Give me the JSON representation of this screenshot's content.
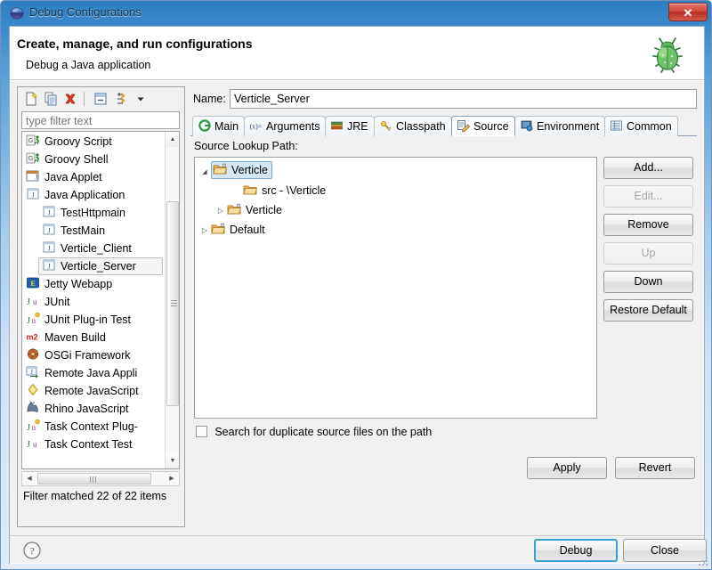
{
  "window": {
    "title": "Debug Configurations",
    "icon": "debug-sphere-icon",
    "close_label": "✕"
  },
  "banner": {
    "title": "Create, manage, and run configurations",
    "subtitle": "Debug a Java application",
    "icon": "green-bug-icon"
  },
  "left_panel": {
    "toolbar": [
      {
        "name": "new-configuration-icon",
        "title": "New launch configuration"
      },
      {
        "name": "duplicate-configuration-icon",
        "title": "Duplicate currently selected launch configuration"
      },
      {
        "name": "delete-configuration-icon",
        "title": "Delete selected launch configuration(s)"
      },
      {
        "name": "collapse-all-icon",
        "title": "Collapse All"
      },
      {
        "name": "filter-launch-configurations-icon",
        "title": "Filter launch configurations"
      },
      {
        "name": "view-menu-chevron-icon",
        "title": "View Menu"
      }
    ],
    "filter": {
      "placeholder": "type filter text",
      "value": ""
    },
    "tree": [
      {
        "label": "Groovy Script",
        "icon": "groovy-script-icon",
        "indent": 0,
        "selected": false
      },
      {
        "label": "Groovy Shell",
        "icon": "groovy-shell-icon",
        "indent": 0,
        "selected": false
      },
      {
        "label": "Java Applet",
        "icon": "java-applet-icon",
        "indent": 0,
        "selected": false
      },
      {
        "label": "Java Application",
        "icon": "java-application-icon",
        "indent": 0,
        "selected": false
      },
      {
        "label": "TestHttpmain",
        "icon": "java-launch-icon",
        "indent": 1,
        "selected": false
      },
      {
        "label": "TestMain",
        "icon": "java-launch-icon",
        "indent": 1,
        "selected": false
      },
      {
        "label": "Verticle_Client",
        "icon": "java-launch-icon",
        "indent": 1,
        "selected": false
      },
      {
        "label": "Verticle_Server",
        "icon": "java-launch-icon",
        "indent": 1,
        "selected": true
      },
      {
        "label": "Jetty Webapp",
        "icon": "jetty-webapp-icon",
        "indent": 0,
        "selected": false
      },
      {
        "label": "JUnit",
        "icon": "junit-icon",
        "indent": 0,
        "selected": false
      },
      {
        "label": "JUnit Plug-in Test",
        "icon": "junit-plugin-test-icon",
        "indent": 0,
        "selected": false
      },
      {
        "label": "Maven Build",
        "icon": "maven-build-icon",
        "indent": 0,
        "selected": false
      },
      {
        "label": "OSGi Framework",
        "icon": "osgi-framework-icon",
        "indent": 0,
        "selected": false
      },
      {
        "label": "Remote Java Appli",
        "icon": "remote-java-application-icon",
        "indent": 0,
        "selected": false
      },
      {
        "label": "Remote JavaScript",
        "icon": "remote-javascript-icon",
        "indent": 0,
        "selected": false
      },
      {
        "label": "Rhino JavaScript",
        "icon": "rhino-javascript-icon",
        "indent": 0,
        "selected": false
      },
      {
        "label": "Task Context Plug-",
        "icon": "task-context-plugin-icon",
        "indent": 0,
        "selected": false
      },
      {
        "label": "Task Context Test",
        "icon": "task-context-test-icon",
        "indent": 0,
        "selected": false
      }
    ],
    "status": "Filter matched 22 of 22 items"
  },
  "right_panel": {
    "name_label": "Name:",
    "name_value": "Verticle_Server",
    "tabs": [
      {
        "label": "Main",
        "icon": "main-tab-icon",
        "active": false
      },
      {
        "label": "Arguments",
        "icon": "arguments-tab-icon",
        "active": false
      },
      {
        "label": "JRE",
        "icon": "jre-tab-icon",
        "active": false
      },
      {
        "label": "Classpath",
        "icon": "classpath-tab-icon",
        "active": false
      },
      {
        "label": "Source",
        "icon": "source-tab-icon",
        "active": true
      },
      {
        "label": "Environment",
        "icon": "environment-tab-icon",
        "active": false
      },
      {
        "label": "Common",
        "icon": "common-tab-icon",
        "active": false
      }
    ],
    "source": {
      "lookup_label": "Source Lookup Path:",
      "tree": [
        {
          "label": "Verticle",
          "icon": "project-folder-icon",
          "indent": 0,
          "arrow": "expanded",
          "selected": true
        },
        {
          "label": "src - \\Verticle",
          "icon": "source-folder-icon",
          "indent": 2,
          "arrow": "none",
          "selected": false
        },
        {
          "label": "Verticle",
          "icon": "project-folder-icon",
          "indent": 1,
          "arrow": "collapsed",
          "selected": false
        },
        {
          "label": "Default",
          "icon": "project-folder-icon",
          "indent": 0,
          "arrow": "collapsed",
          "selected": false
        }
      ],
      "buttons": [
        {
          "label": "Add...",
          "enabled": true
        },
        {
          "label": "Edit...",
          "enabled": false
        },
        {
          "label": "Remove",
          "enabled": true
        },
        {
          "label": "Up",
          "enabled": false
        },
        {
          "label": "Down",
          "enabled": true
        },
        {
          "label": "Restore Default",
          "enabled": true
        }
      ],
      "checkbox": {
        "label": "Search for duplicate source files on the path",
        "checked": false
      }
    },
    "apply_label": "Apply",
    "revert_label": "Revert"
  },
  "footer": {
    "help_icon": "help-question-icon",
    "debug_label": "Debug",
    "close_label": "Close"
  },
  "colors": {
    "title_bar_blue": "#59a3da",
    "close_red": "#bb2f25",
    "selection_blue": "#d4e7f7",
    "focus_blue": "#3c9fd4",
    "panel_gray": "#f0f0f0"
  }
}
